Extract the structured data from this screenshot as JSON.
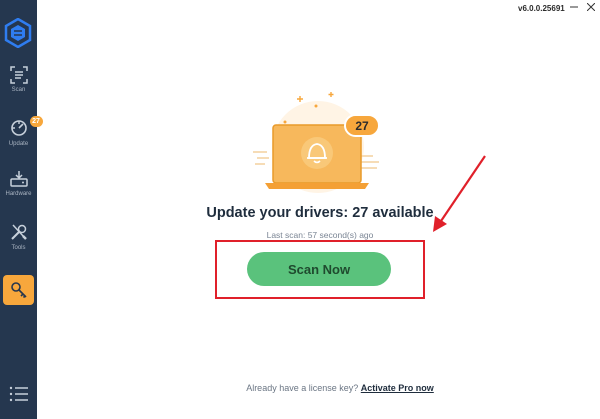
{
  "app": {
    "version": "v6.0.0.25691"
  },
  "sidebar": {
    "items": [
      {
        "label": "Scan",
        "icon": "scan-icon"
      },
      {
        "label": "Update",
        "icon": "update-icon",
        "badge": "27"
      },
      {
        "label": "Hardware",
        "icon": "hardware-icon"
      },
      {
        "label": "Tools",
        "icon": "tools-icon"
      }
    ],
    "active_item": "key-icon",
    "menu_icon": "menu-icon"
  },
  "main": {
    "illustration_badge": "27",
    "headline": "Update your drivers: 27 available",
    "last_scan": "Last scan: 57 second(s) ago",
    "scan_button": "Scan Now",
    "footer_prefix": "Already have a license key?",
    "footer_link": "Activate Pro now"
  },
  "colors": {
    "sidebar_bg": "#25374f",
    "accent_orange": "#f7a73c",
    "scan_green": "#5ac27c",
    "annotation_red": "#e0202a"
  }
}
